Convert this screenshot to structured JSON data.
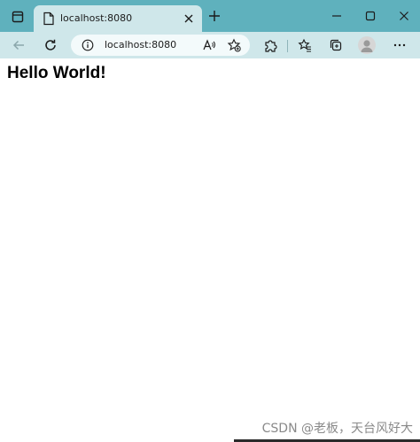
{
  "tab": {
    "title": "localhost:8080"
  },
  "address_bar": {
    "url": "localhost:8080"
  },
  "page": {
    "heading": "Hello World!"
  },
  "watermark": {
    "text": "CSDN @老板，天台风好大"
  },
  "icons": {
    "tab_actions": "tab-actions-icon",
    "favicon": "page-icon",
    "close_tab": "close-icon",
    "new_tab": "plus-icon",
    "minimize": "minimize-icon",
    "maximize": "maximize-icon",
    "close_window": "close-icon",
    "back": "back-arrow-icon",
    "reload": "reload-icon",
    "site_info": "info-icon",
    "read_aloud": "read-aloud-icon",
    "add_favorite": "star-add-icon",
    "extensions": "puzzle-icon",
    "favorites": "favorites-icon",
    "collections": "collections-icon",
    "profile": "avatar-icon",
    "more": "more-icon"
  },
  "colors": {
    "titlebar": "#5fb1bd",
    "toolbar": "#cfe7ea",
    "address_field": "#f3fafb"
  }
}
